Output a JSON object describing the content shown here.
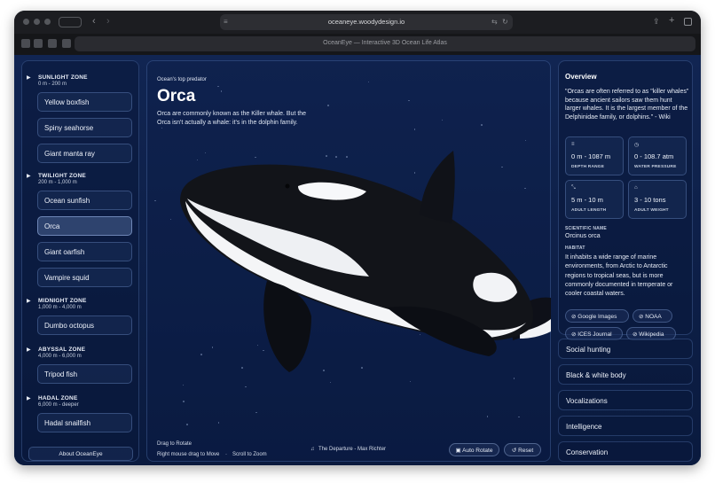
{
  "browser": {
    "url": "oceaneye.woodydesign.io",
    "tab_title": "OceanEye — Interactive 3D Ocean Life Atlas"
  },
  "sidebar": {
    "zones": [
      {
        "name": "SUNLIGHT ZONE",
        "depth": "0 m - 200 m",
        "species": [
          "Yellow boxfish",
          "Spiny seahorse",
          "Giant manta ray"
        ]
      },
      {
        "name": "TWILIGHT ZONE",
        "depth": "200 m - 1,000 m",
        "species": [
          "Ocean sunfish",
          "Orca",
          "Giant oarfish",
          "Vampire squid"
        ]
      },
      {
        "name": "MIDNIGHT ZONE",
        "depth": "1,000 m - 4,000 m",
        "species": [
          "Dumbo octopus"
        ]
      },
      {
        "name": "ABYSSAL ZONE",
        "depth": "4,000 m - 6,000 m",
        "species": [
          "Tripod fish"
        ]
      },
      {
        "name": "HADAL ZONE",
        "depth": "6,000 m - deeper",
        "species": [
          "Hadal snailfish"
        ]
      }
    ],
    "selected": "Orca",
    "about_label": "About OceanEye"
  },
  "main": {
    "kicker": "Ocean's top predator",
    "title": "Orca",
    "description": "Orca are commonly known as the Killer whale. But the Orca isn't actually a whale: it's in the dolphin family.",
    "hint_rotate": "Drag to Rotate",
    "hint_move": "Right mouse drag to Move",
    "hint_sep": "·",
    "hint_zoom": "Scroll to Zoom",
    "music": "The Departure - Max Richter",
    "auto_rotate_label": "Auto Rotate",
    "reset_label": "Reset"
  },
  "details": {
    "overview_title": "Overview",
    "quote": "\"Orcas are often referred to as \"killer whales\" because ancient sailors saw them hunt larger whales. It is the largest member of the Delphinidae family, or dolphins.\" - Wiki",
    "stats": [
      {
        "icon": "depth-icon",
        "value": "0 m - 1087 m",
        "label": "DEPTH RANGE"
      },
      {
        "icon": "pressure-icon",
        "value": "0 - 108.7 atm",
        "label": "WATER PRESSURE"
      },
      {
        "icon": "length-icon",
        "value": "5 m - 10 m",
        "label": "ADULT LENGTH"
      },
      {
        "icon": "weight-icon",
        "value": "3 - 10 tons",
        "label": "ADULT WEIGHT"
      }
    ],
    "scientific_name_label": "SCIENTIFIC NAME",
    "scientific_name": "Orcinus orca",
    "habitat_label": "HABITAT",
    "habitat": "It inhabits a wide range of marine environments, from Arctic to Antarctic regions to tropical seas, but is more commonly documented in temperate or cooler coastal waters.",
    "links": [
      "Google Images",
      "NOAA",
      "ICES Journal",
      "Wikipedia"
    ],
    "sections": [
      "Social hunting",
      "Black & white body",
      "Vocalizations",
      "Intelligence",
      "Conservation"
    ]
  },
  "colors": {
    "background": "#0a1a3e",
    "panel_border": "#4a6aa8",
    "text": "#ffffff"
  }
}
